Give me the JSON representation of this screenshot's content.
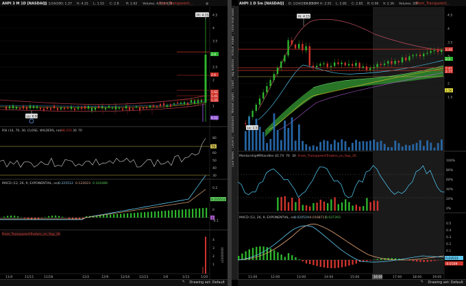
{
  "left": {
    "title": "AHPI 3 M 1D [NASDAQ]",
    "ohlc": [
      "D: 1/24/20",
      "O: 1.37",
      "H: 4.15",
      "L: 1.53",
      "C: 2.8",
      "R: 2.62",
      "Volume: 4,610,918"
    ],
    "study": "From_Transparent...",
    "hi_label": "Hi: 4.15",
    "lo_label": "Lo: 0.92",
    "price_ticks": [
      "4.5",
      "4",
      "3.5",
      "3",
      "2.5",
      "2",
      "1.5",
      "1",
      "0.5"
    ],
    "price_tags": [
      {
        "v": "3.9",
        "color": "#2db52d"
      },
      {
        "v": "2.6",
        "color": "#d0342c"
      },
      {
        "v": "1.62",
        "color": "#d0342c"
      },
      {
        "v": "1.41",
        "color": "#d0342c"
      },
      {
        "v": "1.25",
        "color": "#d0342c"
      },
      {
        "v": "0.51",
        "color": "#8a4fd0"
      }
    ],
    "rsi_title": "RSI (14, 70, 30, CLOSE, WILDERS, no)",
    "rsi_vals": [
      "88.255",
      "30",
      "70"
    ],
    "rsi_ticks": [
      "80",
      "70",
      "60",
      "50",
      "40",
      "30"
    ],
    "rsi_tag": "70",
    "macd_title": "MACD (12, 26, 9, EXPONENTIAL, no)",
    "macd_vals": [
      "0.225512",
      "0.122023",
      "0.102489"
    ],
    "macd_ticks": [
      "0.2",
      "0.1",
      "0",
      "-0.1"
    ],
    "macd_tags": [
      "0.225512",
      "0"
    ],
    "study2_title": "From_TransparentTraders_on_Sep_26",
    "study2_ticks": [
      "4",
      "3",
      "2",
      "1"
    ],
    "study2_vlabel": "x10000000",
    "x_labels": [
      "11/4",
      "11/11",
      "11/18",
      "12/2",
      "12/9",
      "12/16",
      "12/23",
      "1/6",
      "1/13",
      "1/20"
    ],
    "footer": "Drawing set: Default"
  },
  "right": {
    "title": "AHPI 1 D 5m [NASDAQ]",
    "ohlc": [
      "D: 1/24/20 4:05 PM",
      "O: 2.91",
      "H: 2.91",
      "L: 2.85",
      "C: 2.85",
      "R: 0.06",
      "V: 2.36",
      "Volume: 200"
    ],
    "study": "From_Transparent...",
    "hi_label": "Hi: 4.15",
    "lo_label": "Lo: 1.53",
    "tabs": [
      "Time And Sales",
      "Active Trader",
      "Big Buttons",
      "Chart",
      "Market Depth",
      "Dashboard",
      "Level II",
      "Live News"
    ],
    "price_ticks": [
      "4.5",
      "4",
      "3.5",
      "3",
      "2.5",
      "2",
      "1.5"
    ],
    "price_tags": [
      {
        "v": "3.41",
        "color": "#d0342c"
      },
      {
        "v": "3.2",
        "color": "#2db52d"
      },
      {
        "v": "2.81",
        "color": "#d0342c"
      },
      {
        "v": "2.77",
        "color": "#d0342c"
      },
      {
        "v": "2.56",
        "color": "#e6e040"
      }
    ],
    "mid_title": "MentorshipMFKandles",
    "mid_vals": [
      "42.74",
      "70",
      "30"
    ],
    "mid_study": "From_TransparentTraders_on_Sep_26",
    "mid_ticks": [
      "100%",
      "80%",
      "60%",
      "40%",
      "20%",
      "0%"
    ],
    "macd_title": "MACD (12, 26, 9, EXPONENTIAL, no)",
    "macd_vals": [
      "0.020519",
      "-0.0168711",
      "0.037393"
    ],
    "macd_ticks": [
      "0.5",
      "0.4",
      "0.3",
      "0.2",
      "0.1",
      "0",
      "-0.1"
    ],
    "macd_tags": [
      "0.03533",
      "-0.0169"
    ],
    "x_labels": [
      "11:00",
      "12:00",
      "13:00",
      "14:00",
      "15:00",
      "16:00",
      "17:00",
      "18:00",
      "19:00"
    ],
    "x_highlight": "16:00",
    "footer": "Drawing set: Default"
  }
}
